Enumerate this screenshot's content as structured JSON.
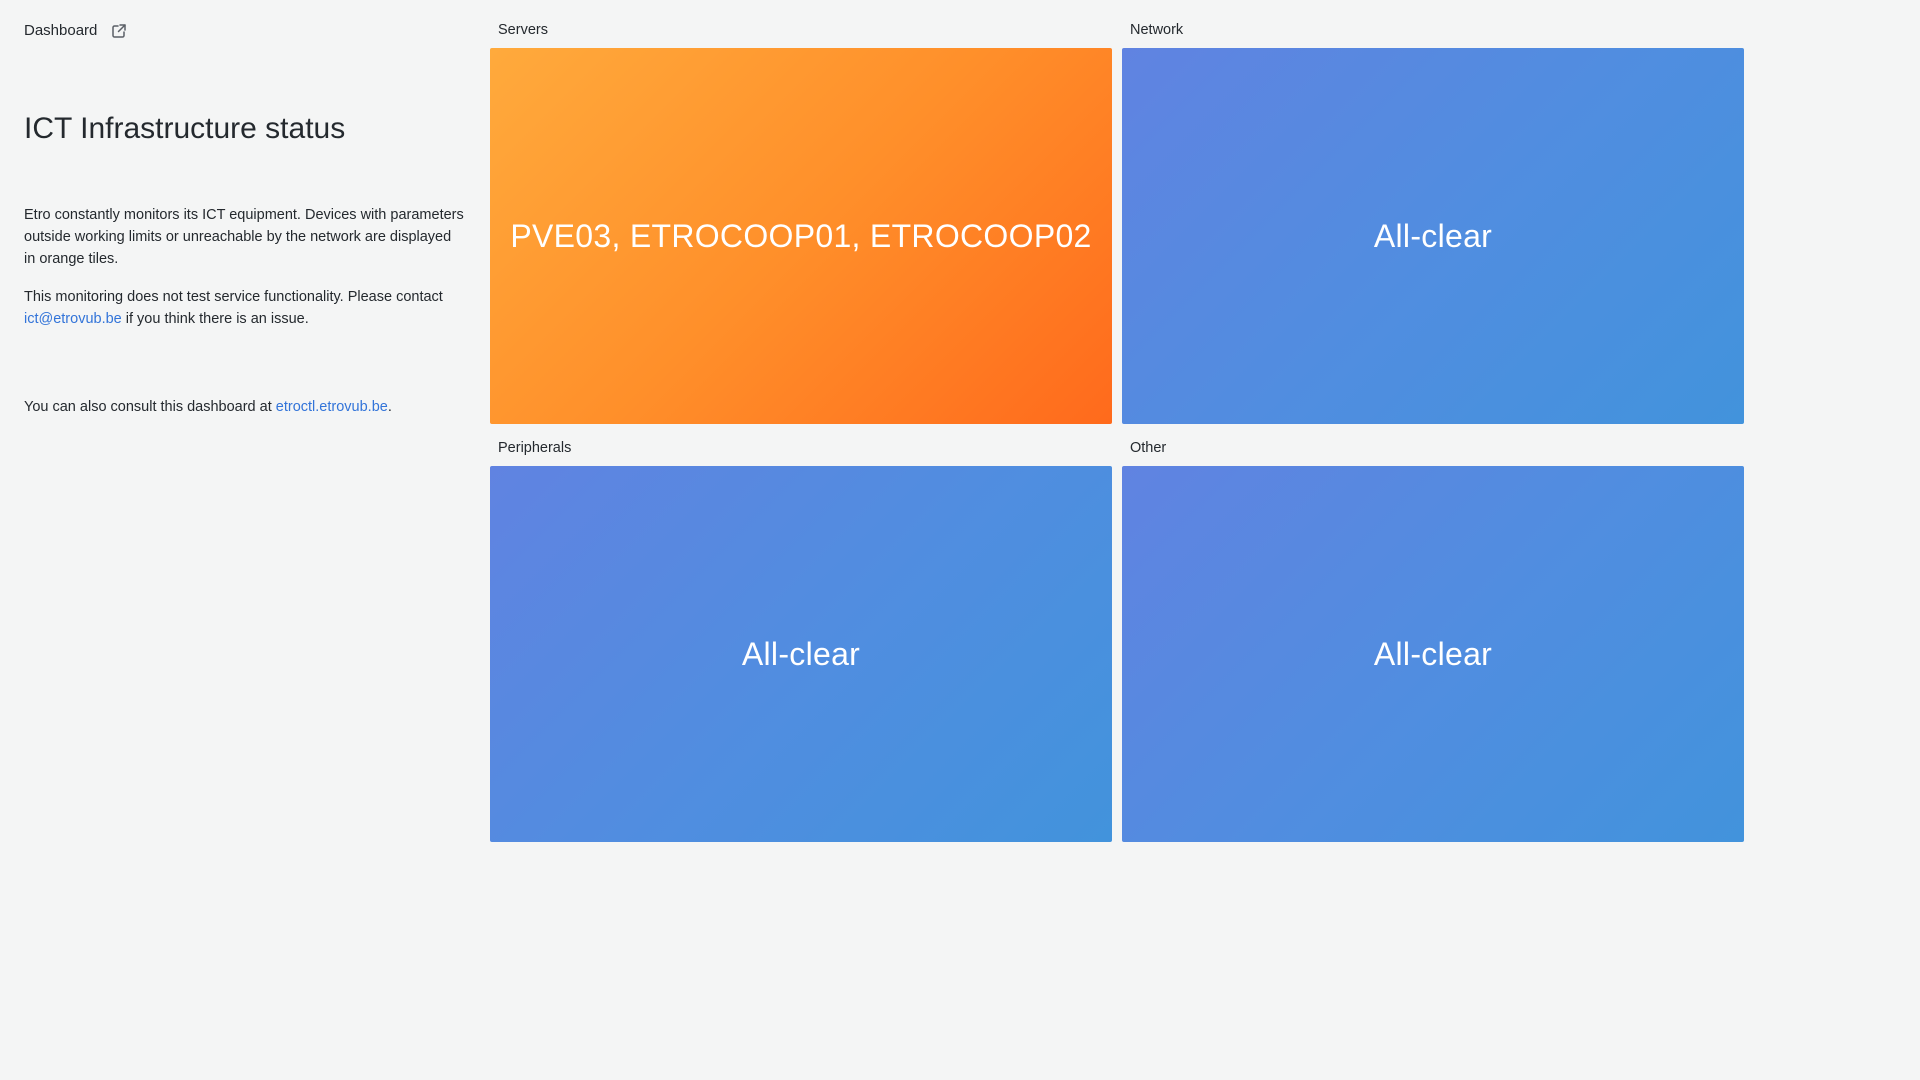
{
  "header": {
    "dashboard_label": "Dashboard",
    "external_icon": "external-link-icon"
  },
  "info": {
    "title": "ICT Infrastructure status",
    "paragraph1": "Etro constantly monitors its ICT equipment. Devices with parameters outside working limits or unreachable by the network are displayed in orange tiles.",
    "paragraph2_before": "This monitoring does not test service functionality. Please contact ",
    "paragraph2_link": "ict@etrovub.be",
    "paragraph2_after": " if you think there is an issue.",
    "paragraph3_before": "You can also consult this dashboard at ",
    "paragraph3_link": "etroctl.etrovub.be",
    "paragraph3_after": "."
  },
  "panels": {
    "servers": {
      "title": "Servers",
      "status": "PVE03, ETROCOOP01, ETROCOOP02",
      "state": "warning"
    },
    "network": {
      "title": "Network",
      "status": "All-clear",
      "state": "ok"
    },
    "peripherals": {
      "title": "Peripherals",
      "status": "All-clear",
      "state": "ok"
    },
    "other": {
      "title": "Other",
      "status": "All-clear",
      "state": "ok"
    }
  },
  "colors": {
    "warning_start": "#ffaa3c",
    "warning_end": "#ff6a1c",
    "ok_start": "#6083e1",
    "ok_end": "#4293dc",
    "link": "#3274d9",
    "background": "#f4f5f5"
  }
}
